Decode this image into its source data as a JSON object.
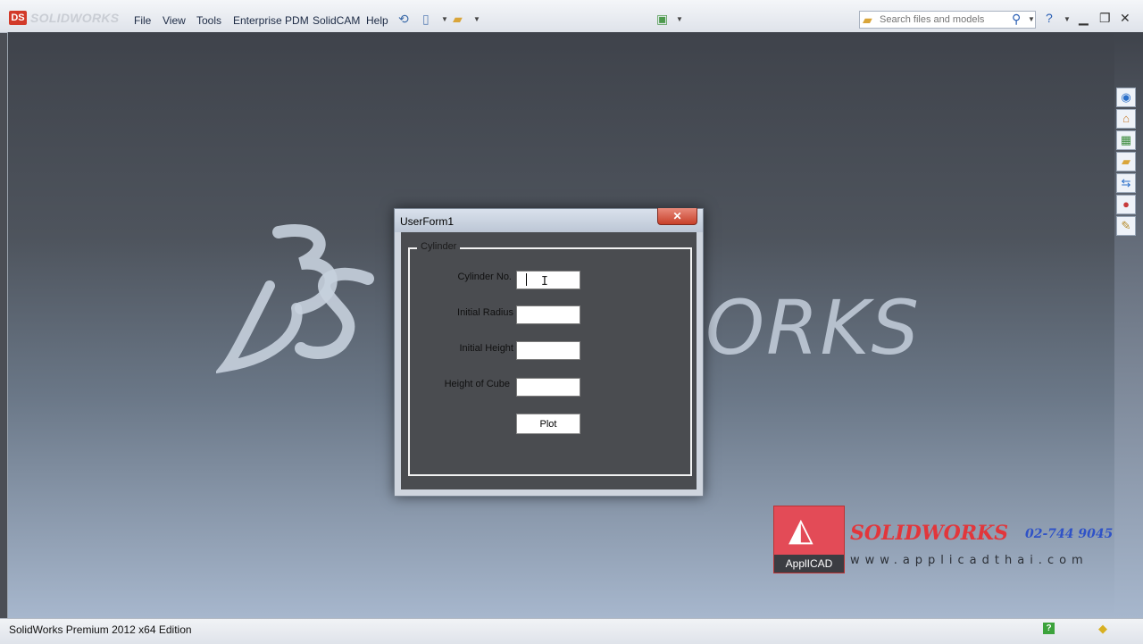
{
  "app": {
    "logo_text": "SOLIDWORKS",
    "logo_badge": "DS"
  },
  "menu": [
    "File",
    "View",
    "Tools",
    "Enterprise PDM",
    "SolidCAM",
    "Help"
  ],
  "search": {
    "placeholder": "Search files and models"
  },
  "watermark": {
    "works_text": "ORKS"
  },
  "dialog": {
    "title": "UserForm1",
    "close_label": "✕",
    "frame_caption": "Cylinder",
    "fields": [
      {
        "label": "Cylinder No.",
        "value": ""
      },
      {
        "label": "Initial Radius",
        "value": ""
      },
      {
        "label": "Initial Height",
        "value": ""
      },
      {
        "label": "Height of Cube",
        "value": ""
      }
    ],
    "plot_label": "Plot"
  },
  "reseller": {
    "box_label": "ApplICAD",
    "brand": "SOLIDWORKS",
    "phone": "02-744 9045",
    "url": "www.applicadthai.com"
  },
  "status": {
    "text": "SolidWorks Premium 2012 x64 Edition"
  },
  "icons": {
    "toolbar": [
      "rebuild-icon",
      "new-document-icon",
      "open-folder-icon",
      "options-icon"
    ],
    "taskpane": [
      "solidworks-resources-icon",
      "design-library-icon",
      "file-explorer-icon",
      "folder-icon",
      "view-palette-icon",
      "appearances-icon",
      "custom-properties-icon"
    ]
  },
  "colors": {
    "accent": "#2a5fb4",
    "close_red": "#c7402a",
    "dialog_client": "#4a4c50"
  }
}
